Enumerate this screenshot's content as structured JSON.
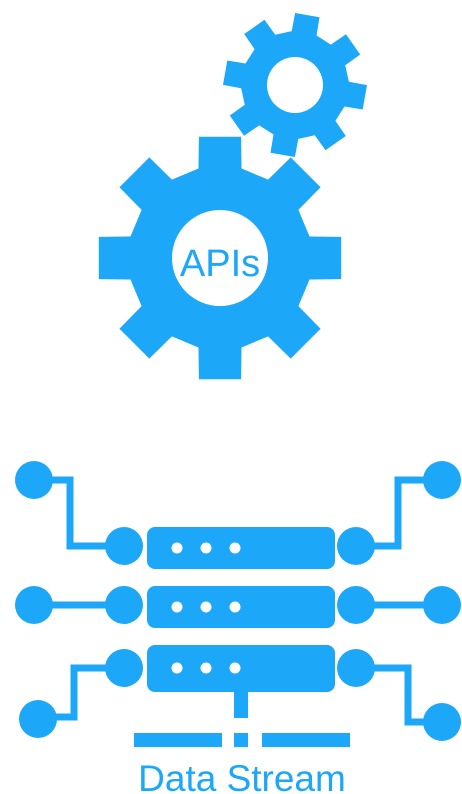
{
  "colors": {
    "primary": "#1CA7F8",
    "background": "#FFFFFF",
    "dots": "#FFFFFF"
  },
  "icons": {
    "small_gear": "gear-icon",
    "large_gear": "gear-icon",
    "server": "server-stack-icon"
  },
  "gears": {
    "label": "APIs"
  },
  "server": {
    "label": "Data Stream",
    "unit_count": 3,
    "dots_per_unit": 3
  }
}
